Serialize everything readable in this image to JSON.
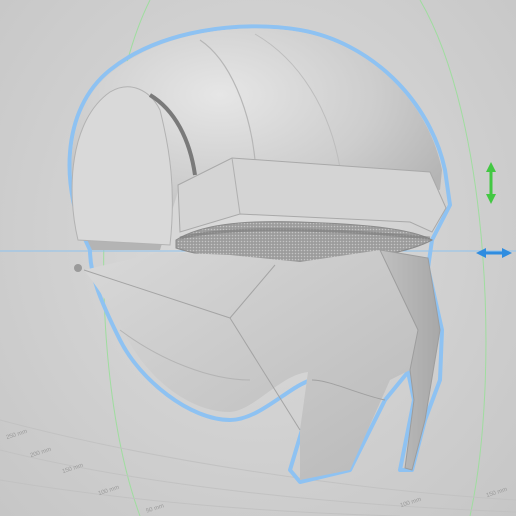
{
  "viewport": {
    "background": "#d4d4d4",
    "model_color": "#c8c8c8",
    "selection_outline_color": "#8ec2f2",
    "axis_green": "#7ed47e",
    "axis_blue": "#4fa3e6",
    "gizmo_green": "#43c843",
    "gizmo_blue": "#2f8de0"
  },
  "grid_labels": [
    {
      "id": "g1",
      "text": "250 mm"
    },
    {
      "id": "g2",
      "text": "200 mm"
    },
    {
      "id": "g3",
      "text": "150 mm"
    },
    {
      "id": "g4",
      "text": "100 mm"
    },
    {
      "id": "g5",
      "text": "50 mm"
    },
    {
      "id": "g6",
      "text": "100 mm"
    },
    {
      "id": "g7",
      "text": "150 mm"
    }
  ],
  "gizmo": {
    "move_vertical_icon": "double-arrow-vertical",
    "move_horizontal_icon": "double-arrow-horizontal"
  }
}
